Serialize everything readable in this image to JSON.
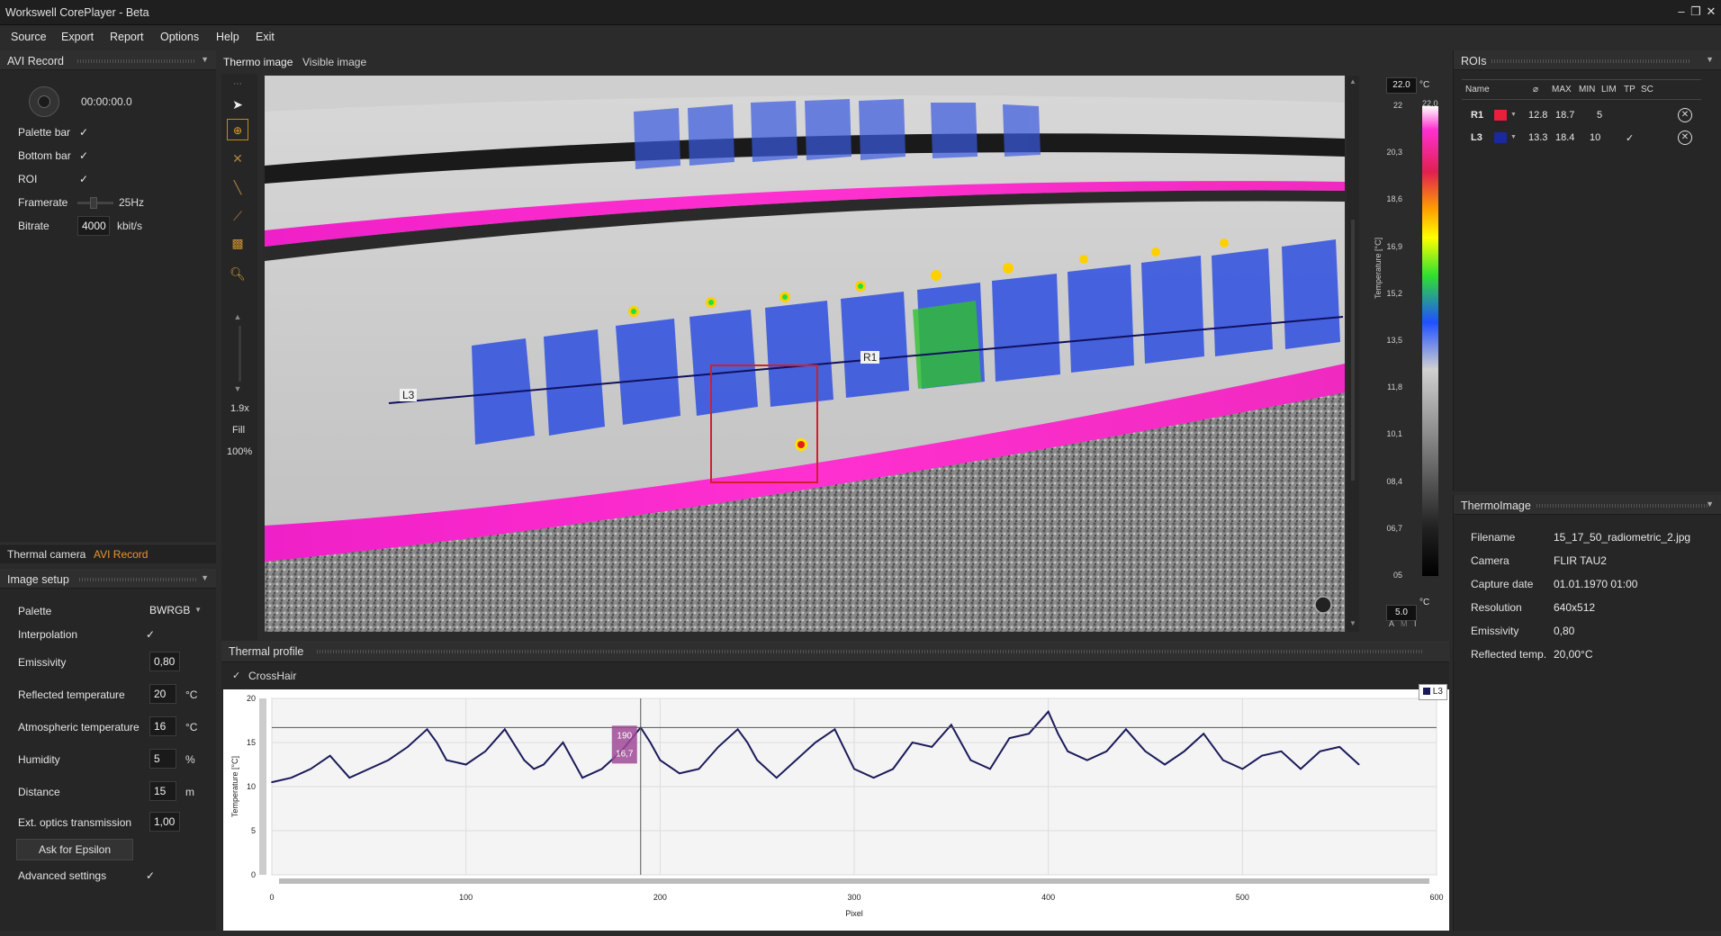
{
  "window": {
    "title": "Workswell CorePlayer - Beta",
    "min": "–",
    "restore": "❐",
    "close": "✕"
  },
  "menu": [
    "Source",
    "Export",
    "Report",
    "Options",
    "Help",
    "Exit"
  ],
  "avi_record": {
    "title": "AVI Record",
    "time": "00:00:00.0",
    "palette_bar_label": "Palette bar",
    "bottom_bar_label": "Bottom bar",
    "roi_label": "ROI",
    "framerate_label": "Framerate",
    "framerate_value": "25Hz",
    "bitrate_label": "Bitrate",
    "bitrate_value": "4000",
    "bitrate_unit": "kbit/s",
    "check": "✓"
  },
  "left_tabs": [
    "Thermal camera",
    "AVI Record"
  ],
  "image_setup": {
    "title": "Image setup",
    "palette_label": "Palette",
    "palette_value": "BWRGB",
    "interpolation_label": "Interpolation",
    "emissivity_label": "Emissivity",
    "emissivity_value": "0,80",
    "reflected_label": "Reflected temperature",
    "reflected_value": "20",
    "reflected_unit": "°C",
    "atmospheric_label": "Atmospheric temperature",
    "atmospheric_value": "16",
    "atmospheric_unit": "°C",
    "humidity_label": "Humidity",
    "humidity_value": "5",
    "humidity_unit": "%",
    "distance_label": "Distance",
    "distance_value": "15",
    "distance_unit": "m",
    "ext_optics_label": "Ext. optics transmission",
    "ext_optics_value": "1,00",
    "ask_epsilon": "Ask for Epsilon",
    "advanced_label": "Advanced settings"
  },
  "view_tabs": [
    "Thermo image",
    "Visible image"
  ],
  "zoom": {
    "factor": "1.9x",
    "fill": "Fill",
    "percent": "100%"
  },
  "thermo_image": {
    "label_l3": "L3",
    "label_r1": "R1"
  },
  "colorbar": {
    "max_value": "22.0",
    "max_unit": "°C",
    "min_value": "5.0",
    "min_unit": "°C",
    "top_label": "22.0",
    "axis_label": "Temperature [°C]",
    "ticks": [
      "22",
      "20,3",
      "18,6",
      "16,9",
      "15,2",
      "13,5",
      "11,8",
      "10,1",
      "08,4",
      "06,7",
      "05"
    ],
    "foot": [
      "A",
      "M",
      "I"
    ]
  },
  "rois": {
    "title": "ROIs",
    "columns": [
      "Name",
      "⌀",
      "MAX",
      "MIN",
      "LIM",
      "TP",
      "SC"
    ],
    "rows": [
      {
        "name": "R1",
        "color": "#e8203a",
        "max": "12.8",
        "min": "18.7",
        "lim": "5",
        "tp": ""
      },
      {
        "name": "L3",
        "color": "#1a2a9a",
        "max": "13.3",
        "min": "18.4",
        "lim": "10",
        "tp": "✓"
      }
    ]
  },
  "thermoimage_info": {
    "title": "ThermoImage",
    "rows": [
      {
        "label": "Filename",
        "value": "15_17_50_radiometric_2.jpg"
      },
      {
        "label": "Camera",
        "value": "FLIR TAU2"
      },
      {
        "label": "Capture date",
        "value": "01.01.1970 01:00"
      },
      {
        "label": "Resolution",
        "value": "640x512"
      },
      {
        "label": "Emissivity",
        "value": "0,80"
      },
      {
        "label": "Reflected temp.",
        "value": "20,00°C"
      }
    ]
  },
  "profile": {
    "title": "Thermal profile",
    "crosshair_label": "CrossHair",
    "legend": "L3",
    "cursor_x_label": "190",
    "cursor_y_label": "16,7"
  },
  "chart_data": {
    "type": "line",
    "title": "",
    "xlabel": "Pixel",
    "ylabel": "Temperature [°C]",
    "xlim": [
      0,
      600
    ],
    "ylim": [
      0,
      20
    ],
    "xticks": [
      "0",
      "100",
      "200",
      "300",
      "400",
      "500",
      "600"
    ],
    "yticks": [
      "0",
      "5",
      "10",
      "15",
      "20"
    ],
    "grid": true,
    "legend": "top-right",
    "series": [
      {
        "name": "L3",
        "color": "#1a1a5a",
        "x": [
          0,
          10,
          20,
          30,
          40,
          50,
          60,
          70,
          80,
          85,
          90,
          100,
          110,
          120,
          130,
          135,
          140,
          150,
          160,
          170,
          180,
          190,
          195,
          200,
          210,
          220,
          230,
          240,
          245,
          250,
          260,
          270,
          280,
          290,
          300,
          310,
          320,
          330,
          340,
          350,
          360,
          370,
          380,
          390,
          400,
          405,
          410,
          420,
          430,
          440,
          450,
          460,
          470,
          480,
          490,
          500,
          510,
          520,
          530,
          540,
          550,
          560
        ],
        "y": [
          10.5,
          11,
          12,
          13.5,
          11,
          12,
          13,
          14.5,
          16.5,
          15,
          13,
          12.5,
          14,
          16.5,
          13,
          12,
          12.5,
          15,
          11,
          12,
          14,
          16.7,
          15,
          13,
          11.5,
          12,
          14.5,
          16.5,
          15,
          13,
          11,
          13,
          15,
          16.5,
          12,
          11,
          12,
          15,
          14.5,
          17,
          13,
          12,
          15.5,
          16,
          18.5,
          16,
          14,
          13,
          14,
          16.5,
          14,
          12.5,
          14,
          16,
          13,
          12,
          13.5,
          14,
          12,
          14,
          14.5,
          12.5
        ]
      }
    ]
  }
}
